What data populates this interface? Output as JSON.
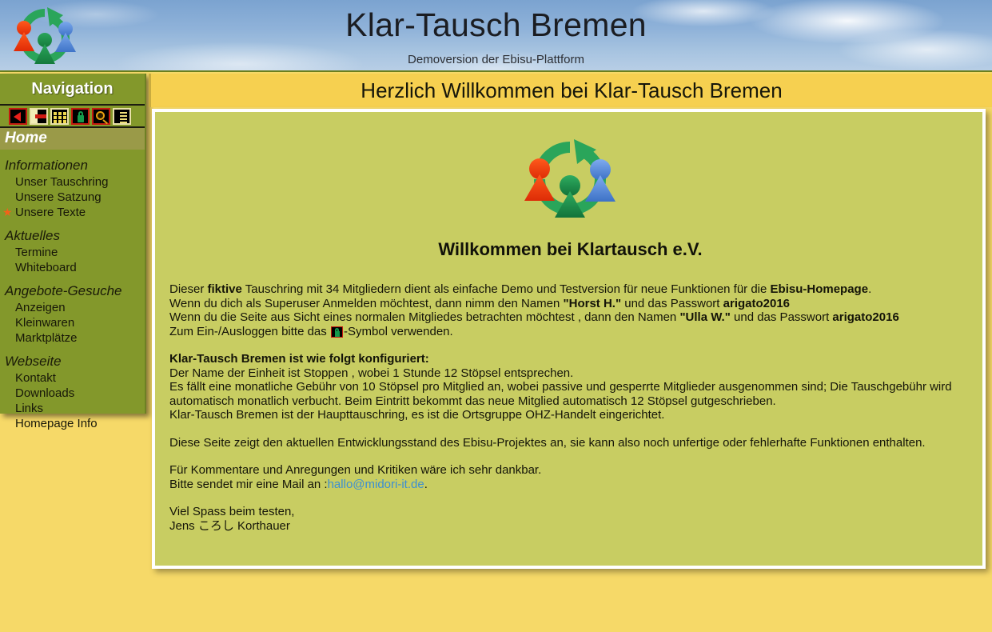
{
  "header": {
    "title": "Klar-Tausch Bremen",
    "subtitle": "Demoversion der Ebisu-Plattform",
    "logo_icon": "klartausch-recycle-logo"
  },
  "sidebar": {
    "nav_title": "Navigation",
    "toolbar_icons": [
      {
        "name": "back-icon",
        "label": "Zurück"
      },
      {
        "name": "minus-icon",
        "label": "Ausblenden"
      },
      {
        "name": "grid-icon",
        "label": "Übersicht"
      },
      {
        "name": "lock-icon",
        "label": "Login"
      },
      {
        "name": "search-icon",
        "label": "Suche"
      },
      {
        "name": "list-icon",
        "label": "Liste"
      }
    ],
    "home_label": "Home",
    "groups": [
      {
        "title": "Informationen",
        "items": [
          {
            "label": "Unser Tauschring",
            "star": false
          },
          {
            "label": "Unsere Satzung",
            "star": false
          },
          {
            "label": "Unsere Texte",
            "star": true
          }
        ]
      },
      {
        "title": "Aktuelles",
        "items": [
          {
            "label": "Termine",
            "star": false
          },
          {
            "label": "Whiteboard",
            "star": false
          }
        ]
      },
      {
        "title": "Angebote-Gesuche",
        "items": [
          {
            "label": "Anzeigen",
            "star": false
          },
          {
            "label": "Kleinwaren",
            "star": false
          },
          {
            "label": "Marktplätze",
            "star": false
          }
        ]
      },
      {
        "title": "Webseite",
        "items": [
          {
            "label": "Kontakt",
            "star": false
          },
          {
            "label": "Downloads",
            "star": false
          },
          {
            "label": "Links",
            "star": false
          },
          {
            "label": "Homepage Info",
            "star": false
          }
        ]
      }
    ]
  },
  "page": {
    "title_bar": "Herzlich Willkommen bei Klar-Tausch Bremen",
    "welcome_heading": "Willkommen bei Klartausch e.V.",
    "para1_a": "Dieser ",
    "para1_b": "fiktive",
    "para1_c": " Tauschring mit 34 Mitgliedern dient als einfache Demo und Testversion für neue Funktionen für die ",
    "para1_d": "Ebisu-Homepage",
    "para1_e": ".",
    "para2_a": "Wenn du dich als Superuser Anmelden möchtest, dann nimm den Namen ",
    "para2_b": "\"Horst H.\"",
    "para2_c": " und das Passwort ",
    "para2_d": "arigato2016",
    "para3_a": "Wenn du die Seite aus Sicht eines normalen Mitgliedes betrachten möchtest , dann den Namen ",
    "para3_b": "\"Ulla W.\"",
    "para3_c": " und das Passwort ",
    "para3_d": "arigato2016",
    "para4_a": "Zum Ein-/Ausloggen bitte das ",
    "para4_b": "-Symbol verwenden.",
    "config_heading": "Klar-Tausch Bremen ist wie folgt konfiguriert:",
    "config_line1": "Der Name der Einheit ist Stoppen , wobei 1 Stunde 12 Stöpsel entsprechen.",
    "config_line2": "Es fällt eine monatliche Gebühr von 10 Stöpsel pro Mitglied an, wobei passive und gesperrte Mitglieder ausgenommen sind; Die Tauschgebühr wird automatisch monatlich verbucht. Beim Eintritt bekommt das neue Mitglied automatisch 12 Stöpsel gutgeschrieben.",
    "config_line3": "Klar-Tausch Bremen ist der Haupttauschring, es ist die Ortsgruppe OHZ-Handelt eingerichtet.",
    "dev_note": "Diese Seite zeigt den aktuellen Entwicklungsstand des Ebisu-Projektes an, sie kann also noch unfertige oder fehlerhafte Funktionen enthalten.",
    "feedback_line1": "Für Kommentare und Anregungen und Kritiken wäre ich sehr dankbar.",
    "feedback_line2_a": "Bitte sendet mir eine Mail an :",
    "feedback_email": "hallo@midori-it.de",
    "feedback_line2_b": ".",
    "signoff_line1": "Viel Spass beim testen,",
    "signoff_line2": "Jens ころし Korthauer"
  },
  "colors": {
    "page_background": "#f6d968",
    "sidebar": "#83982b",
    "sidebar_active": "#9a9a48",
    "title_bar": "#f6d050",
    "content_panel": "#c8cd62",
    "link": "#3c8fd2",
    "star": "#f4611a",
    "logo_red": "#ef3b12",
    "logo_green": "#1f9b4e",
    "logo_blue": "#5b8fdc"
  }
}
